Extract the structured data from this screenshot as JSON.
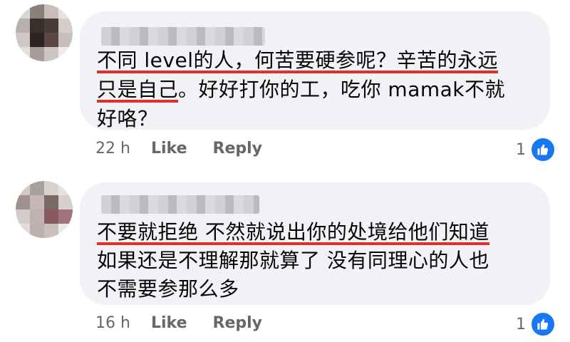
{
  "comments": [
    {
      "lines": [
        [
          {
            "t": "不同 level的人，何苦要硬参呢？辛苦的永远",
            "u": true
          }
        ],
        [
          {
            "t": "只是自己",
            "u": true
          },
          {
            "t": "。好好打你的工，吃你 mamak不就",
            "u": false
          }
        ],
        [
          {
            "t": "好咯？",
            "u": false
          }
        ]
      ],
      "time": "22 h",
      "like_label": "Like",
      "reply_label": "Reply",
      "reaction_count": "1",
      "avatar_colors": [
        "#d9d6d4",
        "#8a7f79",
        "#c9bebb",
        "#e6e4e3",
        "#b8b0ad",
        "#3a2e2c",
        "#4a3a37",
        "#d4cdcb",
        "#cfc8c6",
        "#2d2422",
        "#5b4743",
        "#c7bfbc",
        "#e2dfde",
        "#a79c98",
        "#cdc5c2",
        "#eeeceb"
      ]
    },
    {
      "lines": [
        [
          {
            "t": "不要就拒绝 不然就说出你的处境给他们知道",
            "u": true
          }
        ],
        [
          {
            "t": "如果还是不理解那就算了 没有同理心的人也",
            "u": false
          }
        ],
        [
          {
            "t": "不需要参那么多",
            "u": false
          }
        ]
      ],
      "time": "16 h",
      "like_label": "Like",
      "reply_label": "Reply",
      "reaction_count": "1",
      "avatar_colors": [
        "#cfcbc9",
        "#a7a09d",
        "#d8d2cf",
        "#e4e1df",
        "#9d9290",
        "#c7b6b5",
        "#7b6865",
        "#d6cfcc",
        "#d4cdca",
        "#bfb2b0",
        "#8a5a62",
        "#a0747b",
        "#e1dcda",
        "#bcb1ae",
        "#cbbfbc",
        "#ecebea"
      ]
    }
  ],
  "colors": {
    "bubble": "#f0f2f5",
    "underline": "#e0302a",
    "meta_text": "#65676b",
    "like_blue": "#1877f2"
  },
  "icons": {
    "reaction": "thumbs-up-icon"
  }
}
